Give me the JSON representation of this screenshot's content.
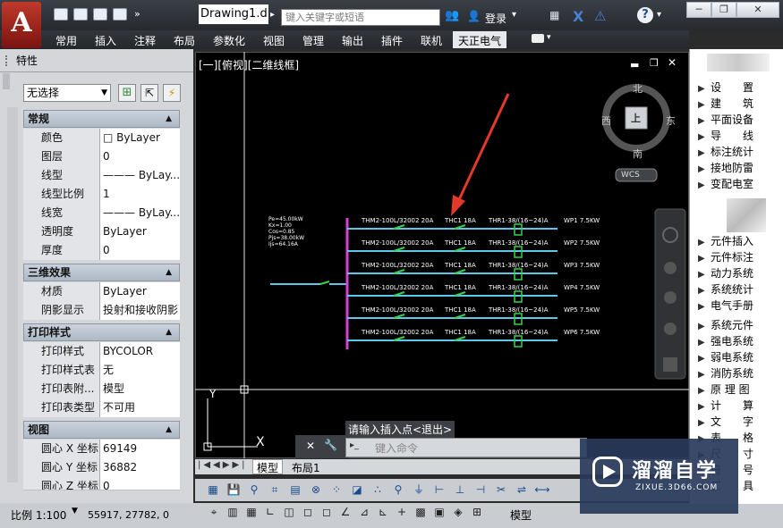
{
  "window": {
    "doc_title": "Drawing1.d...",
    "search_placeholder": "键入关键字或短语",
    "login": "登录"
  },
  "ribbon": {
    "tabs": [
      "常用",
      "插入",
      "注释",
      "布局",
      "参数化",
      "视图",
      "管理",
      "输出",
      "插件",
      "联机"
    ],
    "active_tab": "天正电气"
  },
  "props": {
    "title": "特性",
    "selection": "无选择",
    "sections": {
      "general": "常规",
      "3d": "三维效果",
      "print": "打印样式",
      "view": "视图"
    },
    "general_rows": [
      {
        "label": "颜色",
        "value": "□ ByLayer"
      },
      {
        "label": "图层",
        "value": "0"
      },
      {
        "label": "线型",
        "value": "——— ByLay..."
      },
      {
        "label": "线型比例",
        "value": "1"
      },
      {
        "label": "线宽",
        "value": "——— ByLay..."
      },
      {
        "label": "透明度",
        "value": "ByLayer"
      },
      {
        "label": "厚度",
        "value": "0"
      }
    ],
    "rows_3d": [
      {
        "label": "材质",
        "value": "ByLayer"
      },
      {
        "label": "阴影显示",
        "value": "投射和接收阴影"
      }
    ],
    "print_rows": [
      {
        "label": "打印样式",
        "value": "BYCOLOR"
      },
      {
        "label": "打印样式表",
        "value": "无"
      },
      {
        "label": "打印表附...",
        "value": "模型"
      },
      {
        "label": "打印表类型",
        "value": "不可用"
      }
    ],
    "view_rows": [
      {
        "label": "圆心 X 坐标",
        "value": "69149"
      },
      {
        "label": "圆心 Y 坐标",
        "value": "36882"
      },
      {
        "label": "圆心 Z 坐标",
        "value": "0"
      }
    ]
  },
  "canvas": {
    "view_label": "[一][俯视][二维线框]",
    "compass": {
      "north": "北",
      "south": "南",
      "east": "东",
      "west": "西",
      "center": "上",
      "wcs": "WCS"
    },
    "circuits": [
      {
        "breaker": "THM2-100L/32002 20A",
        "contactor": "THC1 18A",
        "relay": "THR1-38/(16~24)A",
        "load": "WP1 7.5KW"
      },
      {
        "breaker": "THM2-100L/32002 20A",
        "contactor": "THC1 18A",
        "relay": "THR1-38/(16~24)A",
        "load": "WP2 7.5KW"
      },
      {
        "breaker": "THM2-100L/32002 20A",
        "contactor": "THC1 18A",
        "relay": "THR1-38/(16~24)A",
        "load": "WP3 7.5KW"
      },
      {
        "breaker": "THM2-100L/32002 20A",
        "contactor": "THC1 18A",
        "relay": "THR1-38/(16~24)A",
        "load": "WP4 7.5KW"
      },
      {
        "breaker": "THM2-100L/32002 20A",
        "contactor": "THC1 18A",
        "relay": "THR1-38/(16~24)A",
        "load": "WP5 7.5KW"
      },
      {
        "breaker": "THM2-100L/32002 20A",
        "contactor": "THC1 18A",
        "relay": "THR1-38/(16~24)A",
        "load": "WP6 7.5KW"
      }
    ],
    "params": [
      "Pe=45.00kW",
      "Kx=1.00",
      "Cos=0.85",
      "Pjs=38.00kW",
      "Ijs=64.16A"
    ],
    "prompt": "请输入插入点<退出>",
    "command_placeholder": "键入命令"
  },
  "layout_tabs": {
    "model": "模型",
    "layout1": "布局1"
  },
  "status": {
    "scale": "比例 1:100",
    "coords": "55917, 27782, 0",
    "model": "模型"
  },
  "tz_panel": {
    "items_top": [
      "设　　置",
      "建　　筑",
      "平面设备",
      "导　　线",
      "标注统计",
      "接地防雷",
      "变配电室"
    ],
    "items_mid": [
      "元件插入",
      "元件标注",
      "动力系统",
      "系统统计",
      "电气手册"
    ],
    "items_bottom": [
      "系统元件",
      "强电系统",
      "弱电系统",
      "消防系统",
      "原 理 图",
      "计　　算",
      "文　　字",
      "表　　格",
      "尺　　寸",
      "符　　号",
      "工　　具"
    ]
  },
  "watermark": {
    "title": "溜溜自学",
    "url": "ZIXUE.3D66.COM"
  },
  "colors": {
    "accent": "#c0392b",
    "busbar": "#d442d4",
    "wire": "#5cc8e8",
    "switch": "#37d14a"
  }
}
